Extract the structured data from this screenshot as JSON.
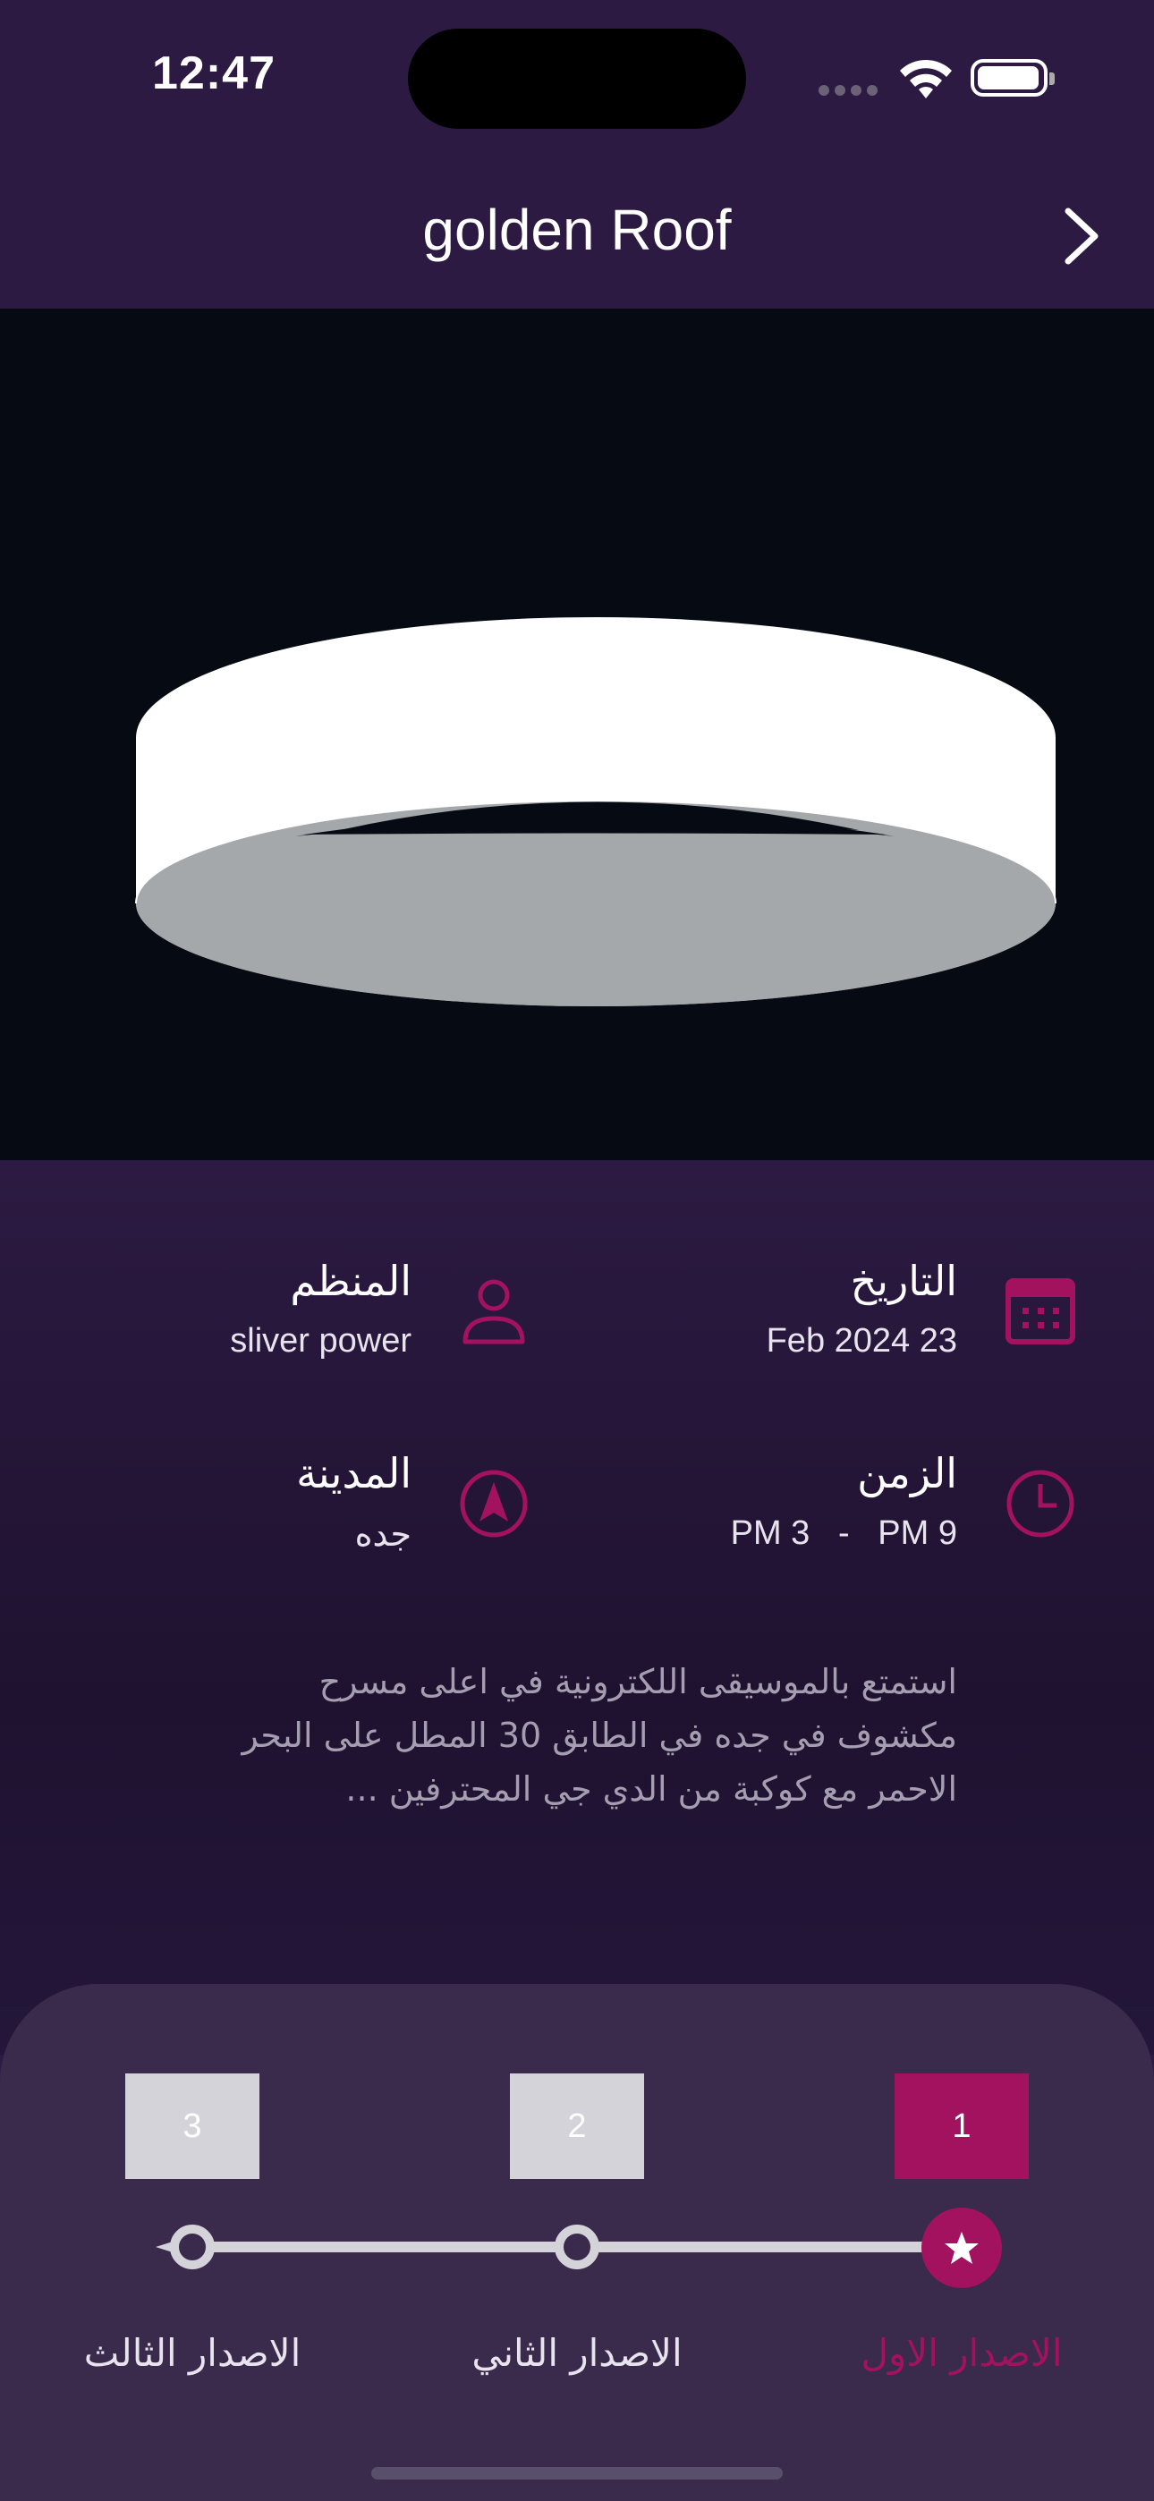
{
  "status_bar": {
    "time": "12:47"
  },
  "nav": {
    "title": "golden Roof",
    "forward_icon": "chevron-right-icon"
  },
  "event": {
    "date": {
      "label": "التاريخ",
      "value": "Feb 2024 23",
      "icon": "calendar-icon"
    },
    "organizer": {
      "label": "المنظم",
      "value": "sliver power",
      "icon": "person-icon"
    },
    "time": {
      "label": "الزمن",
      "value": "PM 3   -   PM 9",
      "icon": "clock-icon"
    },
    "city": {
      "label": "المدينة",
      "value": "جده",
      "icon": "location-arrow-icon"
    },
    "description_lines": [
      "استمتع بالموسيقى اللكترونية في اعلى مسرح",
      "مكشوف في جده في الطابق 30 المطل على البحر",
      "الاحمر مع كوكبة من الدي جي المحترفين ..."
    ]
  },
  "releases": {
    "steps": [
      {
        "number": "1",
        "label": "الاصدار الاول",
        "active": true
      },
      {
        "number": "2",
        "label": "الاصدار الثاني",
        "active": false
      },
      {
        "number": "3",
        "label": "الاصدار الثالث",
        "active": false
      }
    ]
  },
  "colors": {
    "background": "#2c1a42",
    "accent": "#a3125f",
    "inactive": "#d4d3da",
    "panel": "#3a2a4c"
  }
}
